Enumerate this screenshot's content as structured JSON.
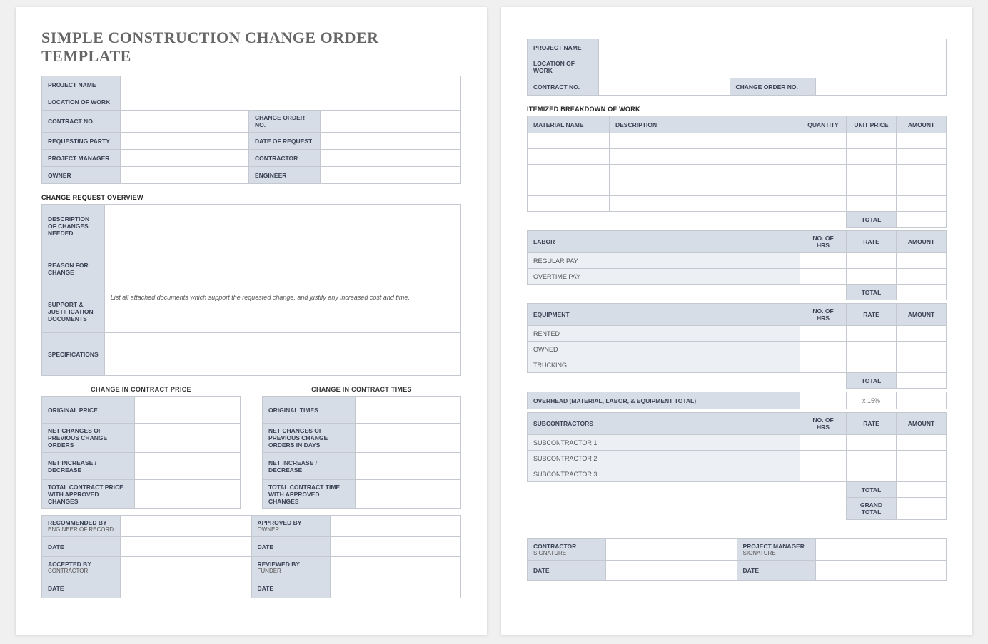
{
  "title": "SIMPLE CONSTRUCTION CHANGE ORDER TEMPLATE",
  "header": {
    "project_name": "PROJECT NAME",
    "location": "LOCATION OF WORK",
    "contract_no": "CONTRACT NO.",
    "change_order_no": "CHANGE ORDER NO.",
    "requesting_party": "REQUESTING PARTY",
    "date_of_request": "DATE OF REQUEST",
    "project_manager": "PROJECT MANAGER",
    "contractor": "CONTRACTOR",
    "owner": "OWNER",
    "engineer": "ENGINEER"
  },
  "overview_title": "CHANGE REQUEST OVERVIEW",
  "overview": {
    "desc": "DESCRIPTION OF CHANGES NEEDED",
    "reason": "REASON FOR CHANGE",
    "support": "SUPPORT & JUSTIFICATION DOCUMENTS",
    "support_hint": "List all attached documents which support the requested change, and justify any increased cost and time.",
    "specs": "SPECIFICATIONS"
  },
  "price": {
    "title": "CHANGE IN CONTRACT PRICE",
    "original": "ORIGINAL PRICE",
    "net_prev": "NET CHANGES OF PREVIOUS CHANGE ORDERS",
    "net_inc": "NET INCREASE / DECREASE",
    "total": "TOTAL CONTRACT PRICE WITH APPROVED CHANGES"
  },
  "times": {
    "title": "CHANGE IN CONTRACT TIMES",
    "original": "ORIGINAL TIMES",
    "net_prev": "NET CHANGES OF PREVIOUS CHANGE ORDERS IN DAYS",
    "net_inc": "NET INCREASE / DECREASE",
    "total": "TOTAL CONTRACT TIME WITH APPROVED CHANGES"
  },
  "sign": {
    "recommended": "RECOMMENDED BY",
    "recommended_sub": "ENGINEER OF RECORD",
    "approved": "APPROVED BY",
    "approved_sub": "OWNER",
    "accepted": "ACCEPTED BY",
    "accepted_sub": "CONTRACTOR",
    "reviewed": "REVIEWED BY",
    "reviewed_sub": "FUNDER",
    "date": "DATE"
  },
  "right_header": {
    "project_name": "PROJECT NAME",
    "location": "LOCATION OF WORK",
    "contract_no": "CONTRACT NO.",
    "change_order_no": "CHANGE ORDER NO."
  },
  "ibw_title": "ITEMIZED BREAKDOWN OF WORK",
  "materials": {
    "cols": {
      "name": "MATERIAL NAME",
      "desc": "DESCRIPTION",
      "qty": "QUANTITY",
      "unit": "UNIT PRICE",
      "amount": "AMOUNT"
    },
    "total": "TOTAL"
  },
  "labor": {
    "title": "LABOR",
    "cols": {
      "hrs": "NO. OF HRS",
      "rate": "RATE",
      "amount": "AMOUNT"
    },
    "regular": "REGULAR PAY",
    "overtime": "OVERTIME PAY",
    "total": "TOTAL"
  },
  "equipment": {
    "title": "EQUIPMENT",
    "cols": {
      "hrs": "NO. OF HRS",
      "rate": "RATE",
      "amount": "AMOUNT"
    },
    "rented": "RENTED",
    "owned": "OWNED",
    "trucking": "TRUCKING",
    "total": "TOTAL"
  },
  "overhead": {
    "title": "OVERHEAD (MATERIAL, LABOR, & EQUIPMENT TOTAL)",
    "rate": "x 15%"
  },
  "subs": {
    "title": "SUBCONTRACTORS",
    "cols": {
      "hrs": "NO. OF HRS",
      "rate": "RATE",
      "amount": "AMOUNT"
    },
    "s1": "SUBCONTRACTOR 1",
    "s2": "SUBCONTRACTOR 2",
    "s3": "SUBCONTRACTOR 3",
    "total": "TOTAL",
    "grand": "GRAND TOTAL"
  },
  "sign_right": {
    "contractor": "CONTRACTOR",
    "pm": "PROJECT MANAGER",
    "sig": "SIGNATURE",
    "date": "DATE"
  }
}
